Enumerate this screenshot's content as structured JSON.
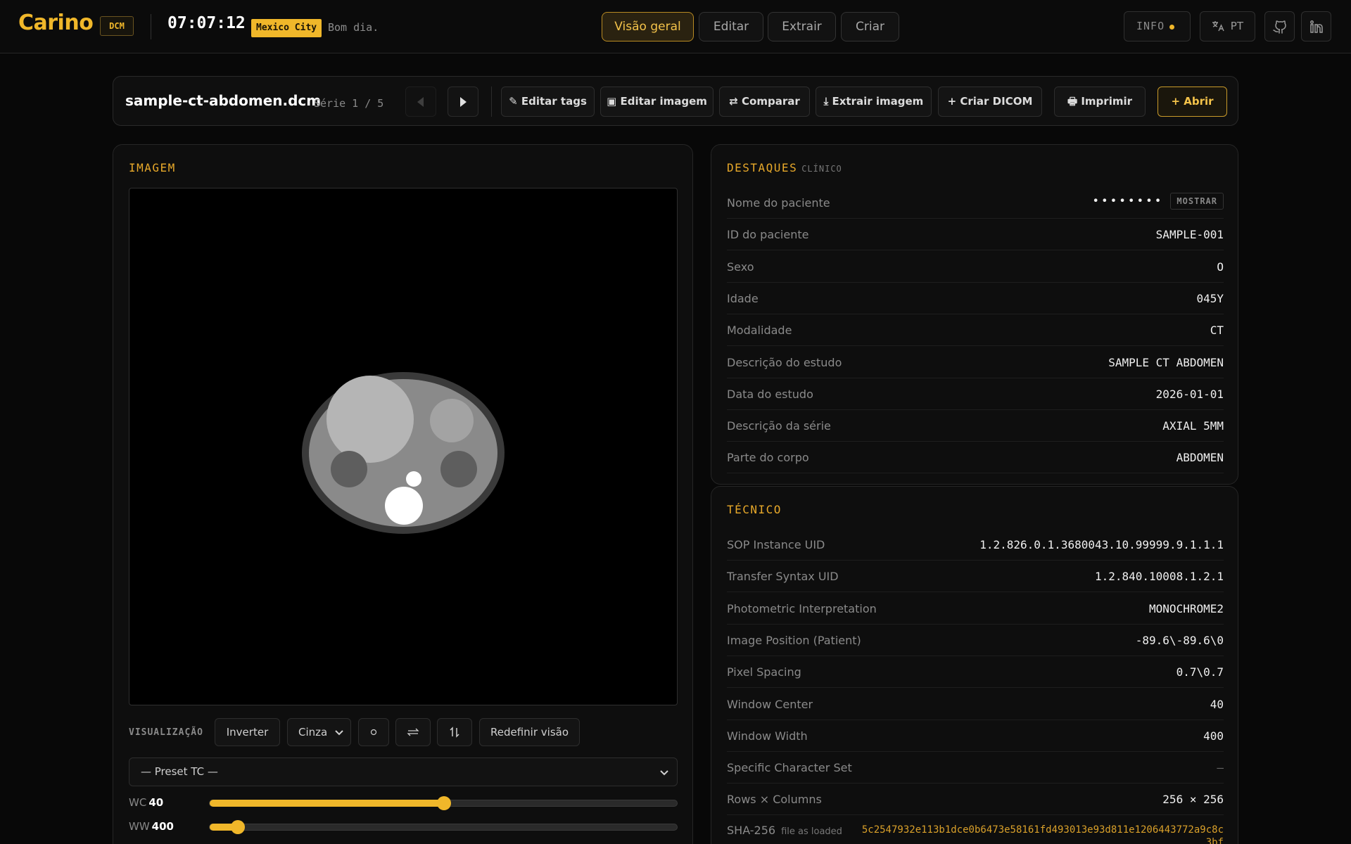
{
  "app": {
    "logo": "Carino",
    "badge": "DCM",
    "clock": "07:07:12",
    "city": "Mexico City",
    "greeting": "Bom dia."
  },
  "nav": {
    "tabs": [
      {
        "label": "Visão geral",
        "active": true
      },
      {
        "label": "Editar",
        "active": false
      },
      {
        "label": "Extrair",
        "active": false
      },
      {
        "label": "Criar",
        "active": false
      }
    ],
    "info_label": "INFO",
    "lang_label": "PT",
    "accent": "#f0b72a"
  },
  "toolbar": {
    "filename": "sample-ct-abdomen.dcm",
    "series": "Série 1 / 5",
    "buttons": {
      "edit_tags": "✎ Editar tags",
      "edit_image": "▣ Editar imagem",
      "compare": "⇄ Comparar",
      "extract_image": "⤓ Extrair imagem",
      "create_dicom": "+ Criar DICOM",
      "print": "🖶 Imprimir",
      "open": "+ Abrir"
    }
  },
  "image_panel": {
    "title": "IMAGEM",
    "visualization_label": "VISUALIZAÇÃO",
    "invert": "Inverter",
    "colormap": "Cinza",
    "reset_view": "Redefinir visão",
    "preset": "— Preset TC —",
    "wc_label": "WC",
    "wc_value": "40",
    "wc_fraction": 0.5,
    "ww_label": "WW",
    "ww_value": "400",
    "ww_fraction": 0.06
  },
  "highlights": {
    "title": "DESTAQUES",
    "subtitle": "CLÍNICO",
    "show_label": "MOSTRAR",
    "rows": [
      {
        "key": "Nome do paciente",
        "value": "••••••••"
      },
      {
        "key": "ID do paciente",
        "value": "SAMPLE-001"
      },
      {
        "key": "Sexo",
        "value": "O"
      },
      {
        "key": "Idade",
        "value": "045Y"
      },
      {
        "key": "Modalidade",
        "value": "CT"
      },
      {
        "key": "Descrição do estudo",
        "value": "SAMPLE CT ABDOMEN"
      },
      {
        "key": "Data do estudo",
        "value": "2026-01-01"
      },
      {
        "key": "Descrição da série",
        "value": "AXIAL 5MM"
      },
      {
        "key": "Parte do corpo",
        "value": "ABDOMEN"
      }
    ]
  },
  "technical": {
    "title": "TÉCNICO",
    "rows": [
      {
        "key": "SOP Instance UID",
        "value": "1.2.826.0.1.3680043.10.99999.9.1.1.1"
      },
      {
        "key": "Transfer Syntax UID",
        "value": "1.2.840.10008.1.2.1"
      },
      {
        "key": "Photometric Interpretation",
        "value": "MONOCHROME2"
      },
      {
        "key": "Image Position (Patient)",
        "value": "-89.6\\-89.6\\0"
      },
      {
        "key": "Pixel Spacing",
        "value": "0.7\\0.7"
      },
      {
        "key": "Window Center",
        "value": "40"
      },
      {
        "key": "Window Width",
        "value": "400"
      },
      {
        "key": "Specific Character Set",
        "value": "—"
      },
      {
        "key": "Rows × Columns",
        "value": "256 × 256"
      }
    ],
    "sha_key": "SHA-256",
    "sha_note": "file as loaded",
    "sha_value": "5c2547932e113b1dce0b6473e58161fd493013e93d811e1206443772a9c8c3bf"
  }
}
